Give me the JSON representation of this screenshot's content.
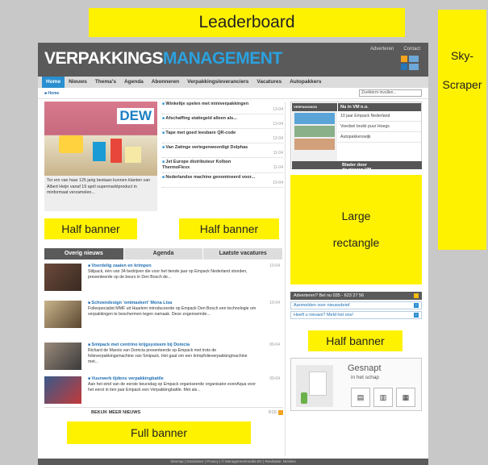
{
  "ads": {
    "leaderboard": "Leaderboard",
    "skyscraper_line1": "Sky-",
    "skyscraper_line2": "Scraper",
    "half_banner_left": "Half banner",
    "half_banner_center": "Half banner",
    "half_banner_right": "Half banner",
    "large_rect_line1": "Large",
    "large_rect_line2": "rectangle",
    "full_banner": "Full banner",
    "ad_color": "#fff200"
  },
  "header": {
    "logo_part1": "VERPAKKINGS",
    "logo_part2": "MANAGEMENT",
    "link_advertise": "Adverteren",
    "link_contact": "Contact"
  },
  "nav": {
    "items": [
      "Home",
      "Nieuws",
      "Thema's",
      "Agenda",
      "Abonneren",
      "Verpakkingsleveranciers",
      "Vacatures",
      "Autopakkers"
    ],
    "active_color": "#2a8fd0"
  },
  "breadcrumb": "■ Home",
  "search": {
    "placeholder": "Zoekterm invullen..."
  },
  "feature": {
    "caption": "Tor ern van haar 125 jarig bestaan kunnen klanten van Albert Heijn vanaf 19 april supermarktproduct in minformaat verzamelen..."
  },
  "news": [
    {
      "title": "Winkeltje spelen met miniverpakkingen",
      "date": "13-04"
    },
    {
      "title": "Afschaffing statiegeld alleen als...",
      "date": "13-04"
    },
    {
      "title": "Tape met goed leesbare QR-code",
      "date": "12-04"
    },
    {
      "title": "Van Zatinge vertegenwoordigt Dolphas",
      "date": "11-04"
    },
    {
      "title": "Jet Europe distributeur Kolbon ThermoFlexx",
      "date": "11-04"
    },
    {
      "title": "Nederlandse machine genomineerd voor...",
      "date": "10-04"
    }
  ],
  "tabs": [
    "Overig nieuws",
    "Agenda",
    "Laatste vacatures"
  ],
  "feed": [
    {
      "title": "Voordelig zaaien en krimpen",
      "body": "Stilpack, één van 34 bedrijven die voor het tiende jaar op Empack Nederland stonden, presenteerde op de beurs in Den Bosch de...",
      "date": "10-04"
    },
    {
      "title": "Schoendesign 'ontmaskert' Mona Lisa",
      "body": "Folieopecialist MMF uit Haarlem introduceerde op Empack Den Bosch een technologie om verpakkingen te beschermen tegen namaak. Deze zogenoemde...",
      "date": "10-04"
    },
    {
      "title": "Smipack met centrino krijgsysteem bij Domcia",
      "body": "Richard de Marois van Domcia presenteerde op Empack met trots de folieverpakkingsmachine van Smipack. Het gaat om een krimpfolieverpakkingmachine met...",
      "date": "09-04"
    },
    {
      "title": "Vuurwerk tijdens verpakkingbattle",
      "body": "Aan het eind van de eerste beursdag op Empack organiseerde organisator evenAqua voor het eerst in tien jaar Empack een Verpakkingbattle. Met als...",
      "date": "09-04"
    }
  ],
  "more_news": {
    "label": "BEKIJK MEER NIEUWS",
    "rss": "RSS"
  },
  "promo": {
    "image_head": "VERPAKKINGS",
    "links_head": "Nu in VM n.o.",
    "links": [
      "10 jaar Empack Nederland",
      "Voedsel bruikt puur Hoegs",
      "Autopakkerswijk"
    ],
    "footer": "Blader door de nieuwe VM"
  },
  "cta": [
    {
      "label": "Adverteren? Bel nu 035 - 623 27 56"
    },
    {
      "label": "Aanmelden voor nieuwsbrief"
    },
    {
      "label": "Heeft u nieuws? Meld het ons!"
    }
  ],
  "gesnapt": {
    "title": "Gesnapt",
    "subtitle": "in het schap"
  },
  "footer": "Sitemap | Disclaimer | Privacy | © Managementmedia BV | Realisatie: Netvlies"
}
